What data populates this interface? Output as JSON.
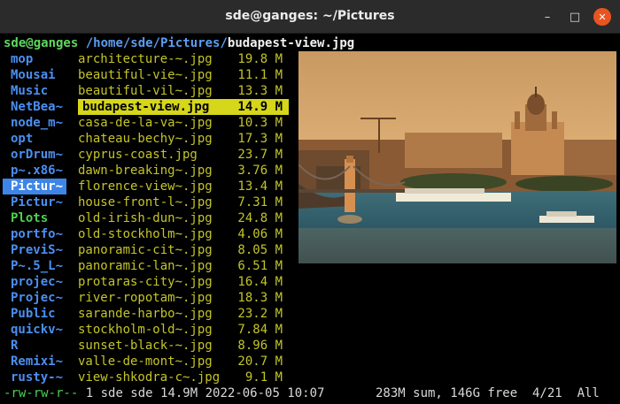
{
  "window": {
    "title": "sde@ganges: ~/Pictures",
    "minimize_glyph": "–",
    "maximize_glyph": "□",
    "close_glyph": "✕"
  },
  "path": {
    "user_host": "sde@ganges",
    "dir": "/home/sde/Pictures/",
    "file": "budapest-view.jpg"
  },
  "parent_dirs": [
    {
      "label": "mop",
      "color": "blue"
    },
    {
      "label": "Mousai",
      "color": "blue"
    },
    {
      "label": "Music",
      "color": "blue"
    },
    {
      "label": "NetBea~",
      "color": "blue"
    },
    {
      "label": "node_m~",
      "color": "blue"
    },
    {
      "label": "opt",
      "color": "blue"
    },
    {
      "label": "orDrum~",
      "color": "blue"
    },
    {
      "label": "p~.x86~",
      "color": "blue"
    },
    {
      "label": "Pictur~",
      "color": "selected"
    },
    {
      "label": "Pictur~",
      "color": "blue"
    },
    {
      "label": "Plots",
      "color": "green"
    },
    {
      "label": "portfo~",
      "color": "blue"
    },
    {
      "label": "PreviS~",
      "color": "blue"
    },
    {
      "label": "P~.5_L~",
      "color": "blue"
    },
    {
      "label": "projec~",
      "color": "blue"
    },
    {
      "label": "Projec~",
      "color": "blue"
    },
    {
      "label": "Public",
      "color": "blue"
    },
    {
      "label": "quickv~",
      "color": "blue"
    },
    {
      "label": "R",
      "color": "blue"
    },
    {
      "label": "Remixi~",
      "color": "blue"
    },
    {
      "label": "rusty-~",
      "color": "blue"
    }
  ],
  "files": [
    {
      "name": "architecture-~.jpg",
      "size": "19.8 M"
    },
    {
      "name": "beautiful-vie~.jpg",
      "size": "11.1 M"
    },
    {
      "name": "beautiful-vil~.jpg",
      "size": "13.3 M"
    },
    {
      "name": "budapest-view.jpg",
      "size": "14.9 M",
      "selected": true
    },
    {
      "name": "casa-de-la-va~.jpg",
      "size": "10.3 M"
    },
    {
      "name": "chateau-bechy~.jpg",
      "size": "17.3 M"
    },
    {
      "name": "cyprus-coast.jpg",
      "size": "23.7 M"
    },
    {
      "name": "dawn-breaking~.jpg",
      "size": "3.76 M"
    },
    {
      "name": "florence-view~.jpg",
      "size": "13.4 M"
    },
    {
      "name": "house-front-l~.jpg",
      "size": "7.31 M"
    },
    {
      "name": "old-irish-dun~.jpg",
      "size": "24.8 M"
    },
    {
      "name": "old-stockholm~.jpg",
      "size": "4.06 M"
    },
    {
      "name": "panoramic-cit~.jpg",
      "size": "8.05 M"
    },
    {
      "name": "panoramic-lan~.jpg",
      "size": "6.51 M"
    },
    {
      "name": "protaras-city~.jpg",
      "size": "16.4 M"
    },
    {
      "name": "river-ropotam~.jpg",
      "size": "18.3 M"
    },
    {
      "name": "sarande-harbo~.jpg",
      "size": "23.2 M"
    },
    {
      "name": "stockholm-old~.jpg",
      "size": "7.84 M"
    },
    {
      "name": "sunset-black-~.jpg",
      "size": "8.96 M"
    },
    {
      "name": "valle-de-mont~.jpg",
      "size": "20.7 M"
    },
    {
      "name": "view-shkodra-c~.jpg",
      "size": "9.1 M"
    }
  ],
  "status": {
    "permissions": "-rw-rw-r--",
    "info": " 1 sde sde 14.9M 2022-06-05 10:07",
    "summary": "283M sum, 146G free  4/21  All"
  },
  "colors": {
    "terminal_bg": "#000000",
    "dir_blue": "#4b8ff0",
    "dir_green": "#4ed04e",
    "file_yellow": "#c4c42a",
    "selection_yellow": "#d6d61a",
    "selection_blue": "#3d86e8",
    "close_button": "#e95420"
  }
}
